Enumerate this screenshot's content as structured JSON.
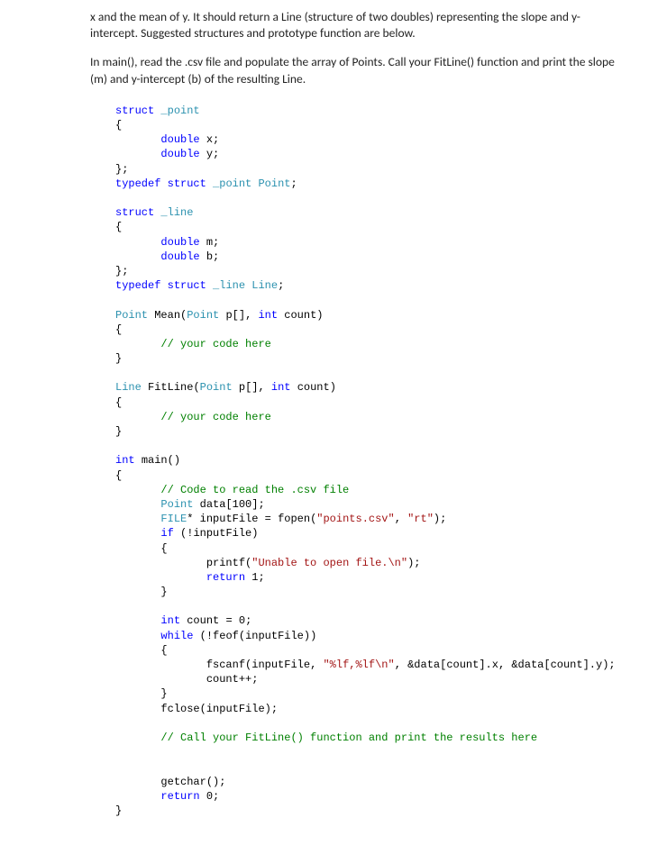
{
  "paragraphs": {
    "p1": "x and the mean of y. It should return a Line (structure of two doubles) representing the slope and y-intercept. Suggested structures and prototype function are below.",
    "p2": "In main(), read the .csv file and populate the array of Points. Call your FitLine() function and print the slope (m) and y-intercept (b) of the resulting Line."
  },
  "code": {
    "kw_struct": "struct",
    "kw_typedef": "typedef",
    "kw_double": "double",
    "kw_int": "int",
    "kw_if": "if",
    "kw_while": "while",
    "kw_return": "return",
    "type_point_tag": "_point",
    "type_line_tag": "_line",
    "type_Point": "Point",
    "type_Line": "Line",
    "type_FILE": "FILE",
    "id_x": "x",
    "id_y": "y",
    "id_m": "m",
    "id_b": "b",
    "id_Mean": "Mean",
    "id_FitLine": "FitLine",
    "id_p": "p",
    "id_count": "count",
    "id_main": "main",
    "id_data": "data",
    "id_inputFile": "inputFile",
    "id_fopen": "fopen",
    "id_printf": "printf",
    "id_feof": "feof",
    "id_fscanf": "fscanf",
    "id_fclose": "fclose",
    "id_getchar": "getchar",
    "cmt_your_code": "// your code here",
    "cmt_read_csv": "// Code to read the .csv file",
    "cmt_call_fitline": "// Call your FitLine() function and print the results here",
    "str_points_csv": "\"points.csv\"",
    "str_rt": "\"rt\"",
    "str_unable": "\"Unable to open file.\\n\"",
    "str_scanfmt": "\"%lf,%lf\\n\"",
    "num_100": "100",
    "num_1": "1",
    "num_0a": "0",
    "num_0b": "0",
    "punct_star": "*",
    "punct_eq": " = ",
    "punct_semicolon": ";",
    "punct_comma": ", ",
    "punct_lbrace": "{",
    "punct_rbrace": "}",
    "punct_rbrace_sc": "};",
    "punct_lbracket": "[",
    "punct_rbracket": "]",
    "punct_empty_br": "[]",
    "punct_lparen": "(",
    "punct_rparen": ")",
    "punct_not": "!",
    "punct_inc": "++;",
    "punct_amp": "&",
    "punct_dotx": ".x",
    "punct_doty": ".y",
    "punct_rparen_sc": ");"
  }
}
